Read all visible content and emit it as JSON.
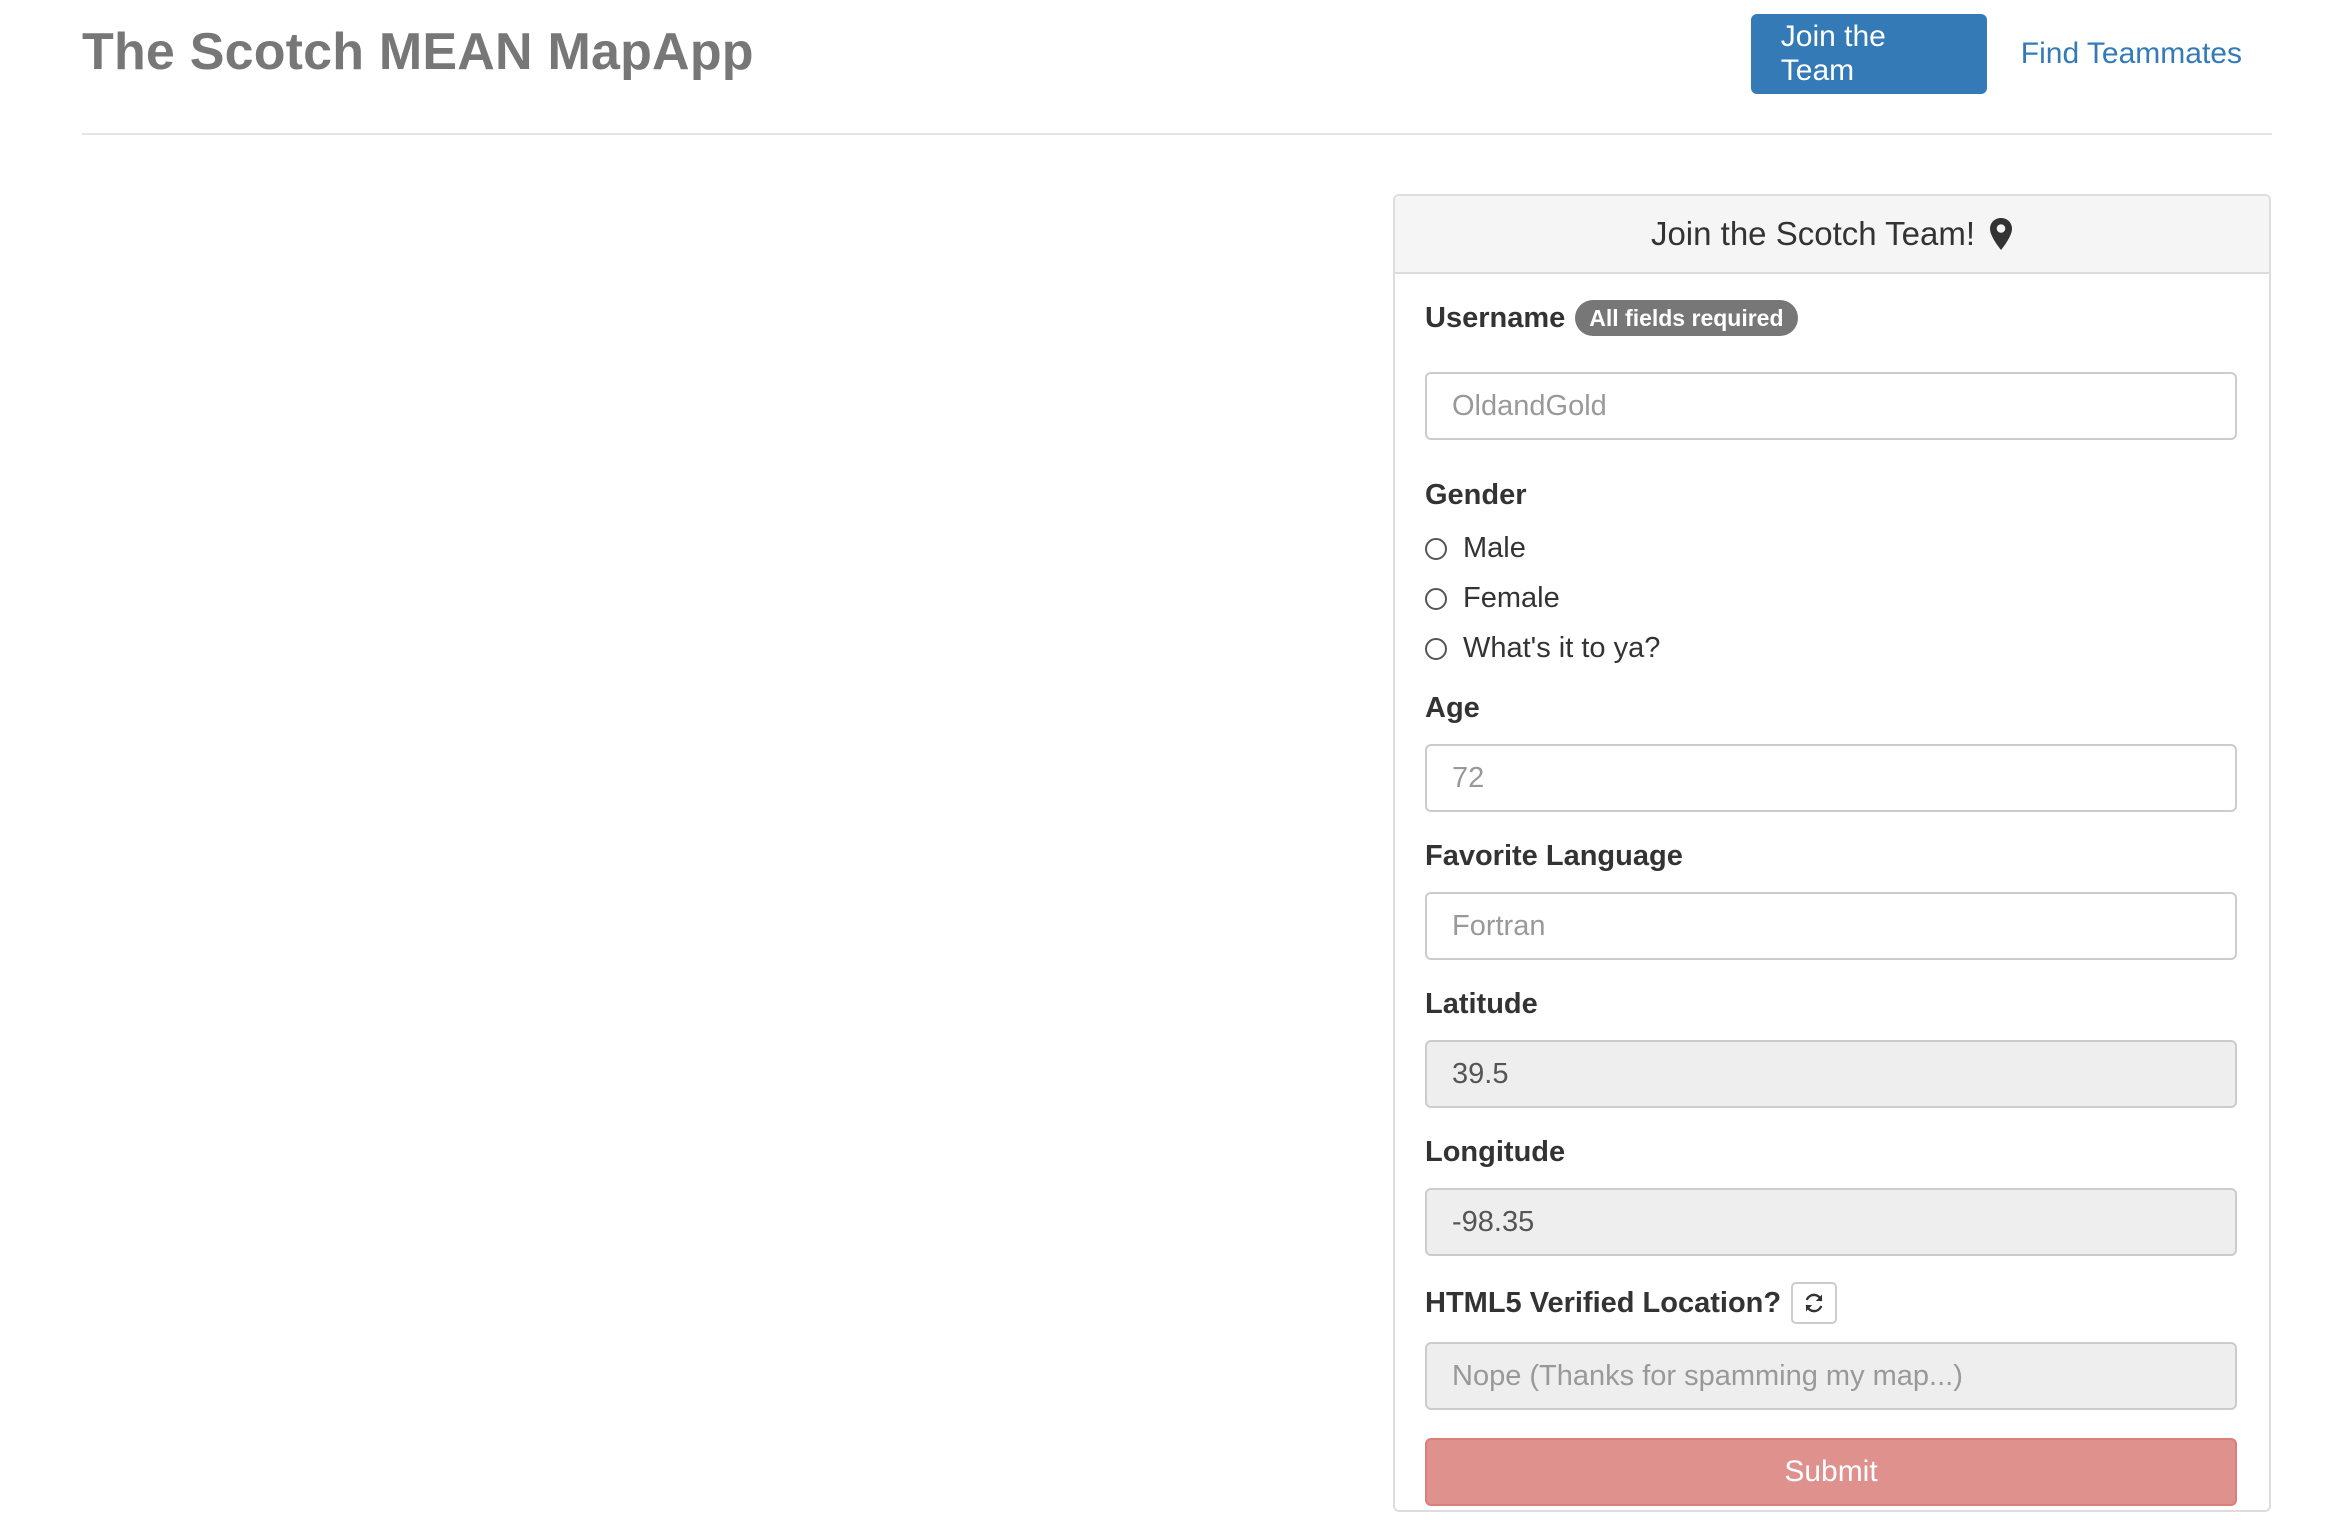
{
  "header": {
    "brand": "The Scotch MEAN MapApp",
    "nav": {
      "join_label": "Join the Team",
      "find_label": "Find Teammates"
    }
  },
  "form": {
    "title": "Join the Scotch Team!",
    "title_icon": "map-marker-icon",
    "username": {
      "label": "Username",
      "badge": "All fields required",
      "placeholder": "OldandGold"
    },
    "gender": {
      "label": "Gender",
      "options": [
        "Male",
        "Female",
        "What's it to ya?"
      ]
    },
    "age": {
      "label": "Age",
      "placeholder": "72"
    },
    "language": {
      "label": "Favorite Language",
      "placeholder": "Fortran"
    },
    "latitude": {
      "label": "Latitude",
      "value": "39.5"
    },
    "longitude": {
      "label": "Longitude",
      "value": "-98.35"
    },
    "verified": {
      "label": "HTML5 Verified Location?",
      "refresh_icon": "refresh-icon",
      "placeholder": "Nope (Thanks for spamming my map...)"
    },
    "submit_label": "Submit"
  },
  "colors": {
    "primary": "#337ab7",
    "submit": "#df918d",
    "badge": "#777777",
    "readonly_bg": "#eeeeee"
  }
}
